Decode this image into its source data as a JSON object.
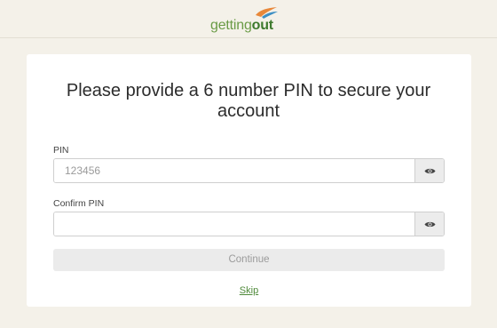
{
  "brand": {
    "name_part1": "getting",
    "name_part2": "out",
    "logo_colors": {
      "light_green": "#6a9b46",
      "dark_green": "#3e7a2e",
      "orange": "#e8883a",
      "blue": "#3d8fc4"
    }
  },
  "form": {
    "title": "Please provide a 6 number PIN to secure your account",
    "pin": {
      "label": "PIN",
      "placeholder": "123456",
      "value": ""
    },
    "confirm_pin": {
      "label": "Confirm PIN",
      "placeholder": "",
      "value": ""
    },
    "continue_label": "Continue",
    "skip_label": "Skip"
  },
  "icons": {
    "toggle_visibility": "eye-icon",
    "logo_mark": "bird-swoosh-icon"
  }
}
